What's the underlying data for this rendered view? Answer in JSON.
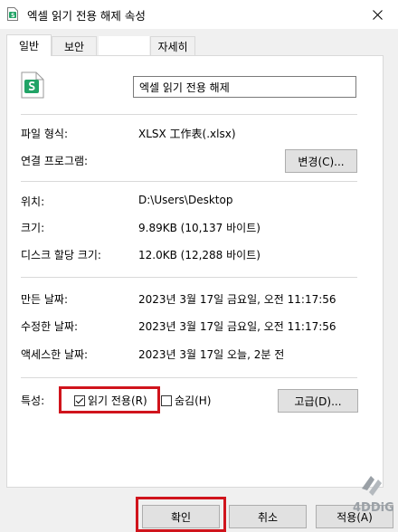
{
  "window": {
    "title": "엑셀 읽기 전용 해제 속성"
  },
  "tabs": [
    {
      "label": "일반"
    },
    {
      "label": "보안"
    },
    {
      "label": ""
    },
    {
      "label": "자세히"
    }
  ],
  "general": {
    "file_name": "엑셀 읽기 전용 해제",
    "file_type_label": "파일 형식:",
    "file_type_value": "XLSX 工作表(.xlsx)",
    "open_with_label": "연결 프로그램:",
    "change_button": "변경(C)...",
    "location_label": "위치:",
    "location_value": "D:\\Users\\Desktop",
    "size_label": "크기:",
    "size_value": "9.89KB (10,137 바이트)",
    "size_on_disk_label": "디스크 할당 크기:",
    "size_on_disk_value": "12.0KB (12,288 바이트)",
    "created_label": "만든 날짜:",
    "created_value": "2023년 3월 17일 금요일, 오전 11:17:56",
    "modified_label": "수정한 날짜:",
    "modified_value": "2023년 3월 17일 금요일, 오전 11:17:56",
    "accessed_label": "액세스한 날짜:",
    "accessed_value": "2023년 3월 17일 오늘, 2분 전",
    "attributes_label": "특성:",
    "readonly_label": "읽기 전용(R)",
    "readonly_checked": true,
    "hidden_label": "숨김(H)",
    "hidden_checked": false,
    "advanced_button": "고급(D)..."
  },
  "footer": {
    "ok_button": "확인",
    "cancel_button": "취소",
    "apply_button": "적용(A)"
  },
  "watermark": {
    "text": "4DDiG"
  },
  "colors": {
    "highlight": "#d0141c",
    "excel_green": "#21a366",
    "watermark": "#9aa0a6"
  },
  "icons": {
    "title": "excel-file-icon",
    "file": "excel-file-icon",
    "close": "close-icon"
  }
}
